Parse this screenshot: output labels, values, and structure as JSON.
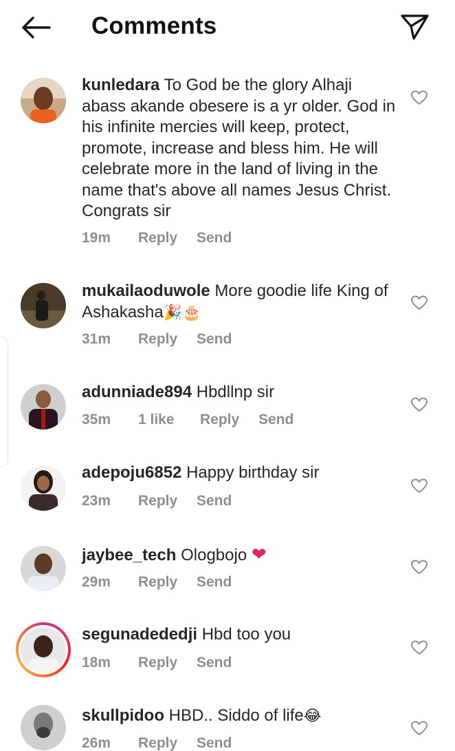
{
  "header": {
    "title": "Comments"
  },
  "comments": [
    {
      "username": "kunledara",
      "text": " To God be the glory Alhaji abass akande obesere is a yr older. God in his infinite mercies will keep, protect, promote, increase and bless him. He will celebrate more in the land of living in the name that's above all names Jesus Christ. Congrats sir",
      "time": "19m",
      "reply": "Reply",
      "send": "Send"
    },
    {
      "username": "mukailaoduwole",
      "text": " More goodie life King of Ashakasha",
      "emoji": "🎉🎂",
      "time": "31m",
      "reply": "Reply",
      "send": "Send"
    },
    {
      "username": "adunniade894",
      "text": " Hbdllnp sir",
      "time": "35m",
      "likes": "1 like",
      "reply": "Reply",
      "send": "Send"
    },
    {
      "username": "adepoju6852",
      "text": " Happy birthday sir",
      "time": "23m",
      "reply": "Reply",
      "send": "Send"
    },
    {
      "username": "jaybee_tech",
      "text": " Ologbojo ",
      "emoji": "❤",
      "time": "29m",
      "reply": "Reply",
      "send": "Send"
    },
    {
      "username": "segunadededji",
      "text": " Hbd too you",
      "time": "18m",
      "reply": "Reply",
      "send": "Send"
    },
    {
      "username": "skullpidoo",
      "text": " HBD.. Siddo of life",
      "emoji": "😂",
      "time": "26m",
      "reply": "Reply",
      "send": "Send"
    }
  ]
}
